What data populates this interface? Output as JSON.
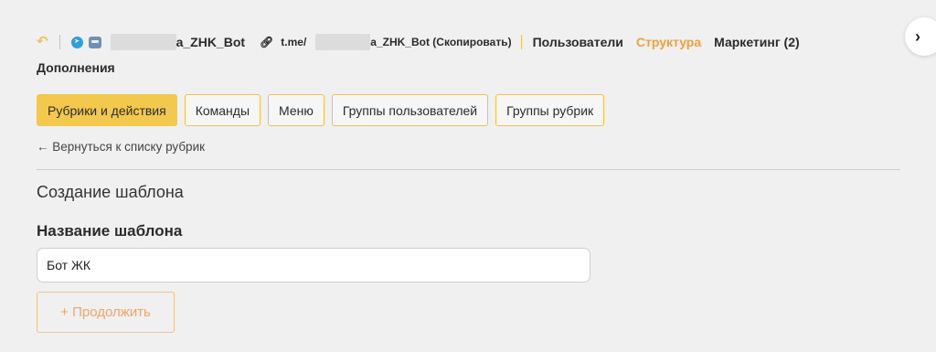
{
  "header": {
    "bot_name_suffix": "а_ZHK_Bot",
    "bot_link_prefix": "t.me/",
    "bot_link_suffix": "а_ZHK_Bot (Скопировать)",
    "nav": [
      {
        "label": "Пользователи"
      },
      {
        "label": "Структура"
      },
      {
        "label": "Маркетинг (2)"
      }
    ],
    "sub_nav_label": "Дополнения"
  },
  "tabs": [
    {
      "label": "Рубрики и действия"
    },
    {
      "label": "Команды"
    },
    {
      "label": "Меню"
    },
    {
      "label": "Группы пользователей"
    },
    {
      "label": "Группы рубрик"
    }
  ],
  "back_link": "← Вернуться к списку рубрик",
  "form": {
    "section_title": "Создание шаблона",
    "field_label": "Название шаблона",
    "field_value": "Бот ЖК",
    "continue_label": "+ Продолжить"
  },
  "icons": {
    "back": "undo-arrow-icon",
    "telegram": "telegram-icon",
    "bot": "bot-icon",
    "link": "link-icon",
    "toggle": "chevron-right-icon"
  },
  "colors": {
    "accent": "#f2c94c",
    "active_nav": "#f0a03c",
    "background": "#f0f0f0"
  }
}
